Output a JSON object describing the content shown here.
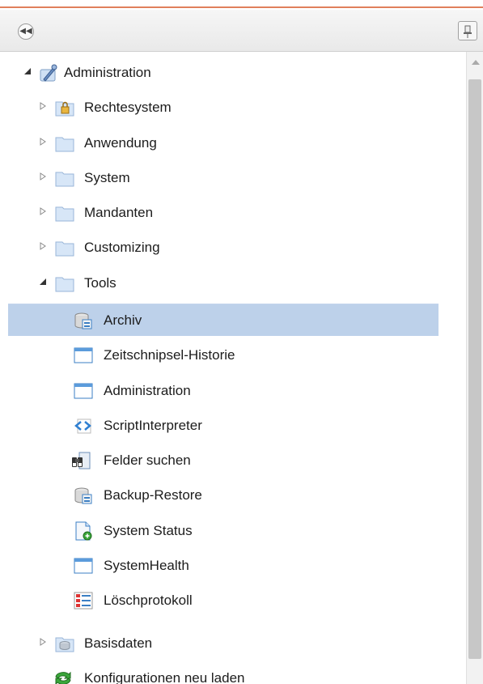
{
  "toolbar": {
    "collapse_icon": "double-chevron-left-icon",
    "pin_icon": "pin-icon"
  },
  "tree": {
    "root": {
      "label": "Administration",
      "icon": "wrench-icon",
      "expanded": true
    },
    "children": [
      {
        "label": "Rechtesystem",
        "icon": "locked-folder-icon"
      },
      {
        "label": "Anwendung",
        "icon": "folder-icon"
      },
      {
        "label": "System",
        "icon": "folder-icon"
      },
      {
        "label": "Mandanten",
        "icon": "folder-icon"
      },
      {
        "label": "Customizing",
        "icon": "folder-icon"
      },
      {
        "label": "Tools",
        "icon": "folder-icon",
        "expanded": true
      }
    ],
    "tools_children": [
      {
        "label": "Archiv",
        "icon": "archive-icon",
        "selected": true
      },
      {
        "label": "Zeitschnipsel-Historie",
        "icon": "window-icon"
      },
      {
        "label": "Administration",
        "icon": "window-icon"
      },
      {
        "label": "ScriptInterpreter",
        "icon": "code-icon"
      },
      {
        "label": "Felder suchen",
        "icon": "binoculars-icon"
      },
      {
        "label": "Backup-Restore",
        "icon": "archive-icon"
      },
      {
        "label": "System Status",
        "icon": "document-status-icon"
      },
      {
        "label": "SystemHealth",
        "icon": "window-icon"
      },
      {
        "label": "Löschprotokoll",
        "icon": "checklist-icon"
      }
    ],
    "after": [
      {
        "label": "Basisdaten",
        "icon": "database-folder-icon"
      },
      {
        "label": "Konfigurationen neu laden",
        "icon": "refresh-icon"
      }
    ]
  },
  "colors": {
    "selection": "#bdd1ea",
    "folder": "#d7e6f7",
    "accent_line": "#e0805c"
  }
}
